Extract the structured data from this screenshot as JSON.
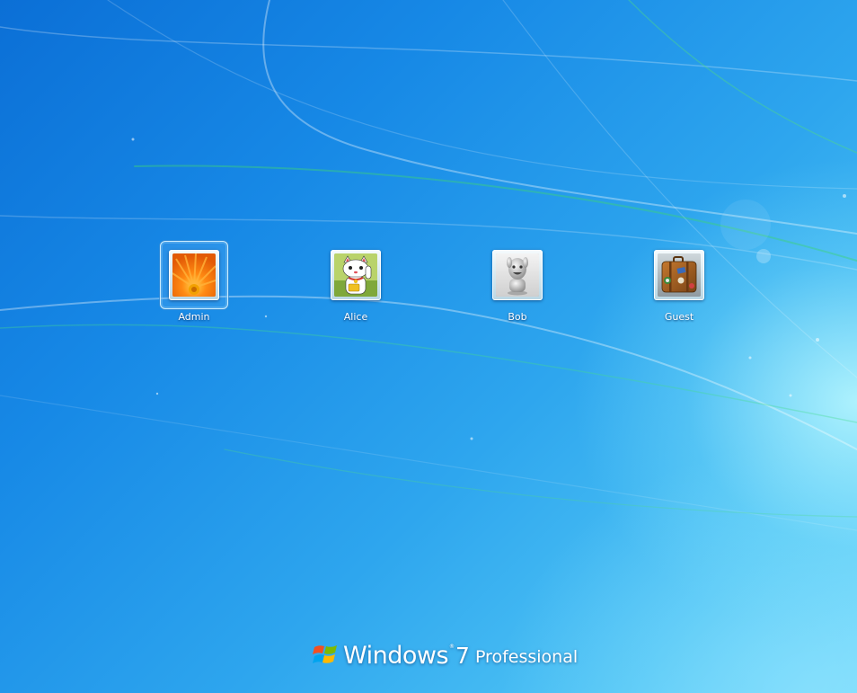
{
  "users": [
    {
      "name": "Admin",
      "picture": "orange-flower-icon",
      "selected": true
    },
    {
      "name": "Alice",
      "picture": "lucky-cat-icon",
      "selected": false
    },
    {
      "name": "Bob",
      "picture": "robot-figure-icon",
      "selected": false
    },
    {
      "name": "Guest",
      "picture": "suitcase-icon",
      "selected": false
    }
  ],
  "branding": {
    "word": "Windows",
    "tm": "®",
    "version": "7",
    "edition": "Professional"
  },
  "colors": {
    "background_dark": "#0b6fd6",
    "background_light": "#72d8fa",
    "text": "#ffffff"
  }
}
